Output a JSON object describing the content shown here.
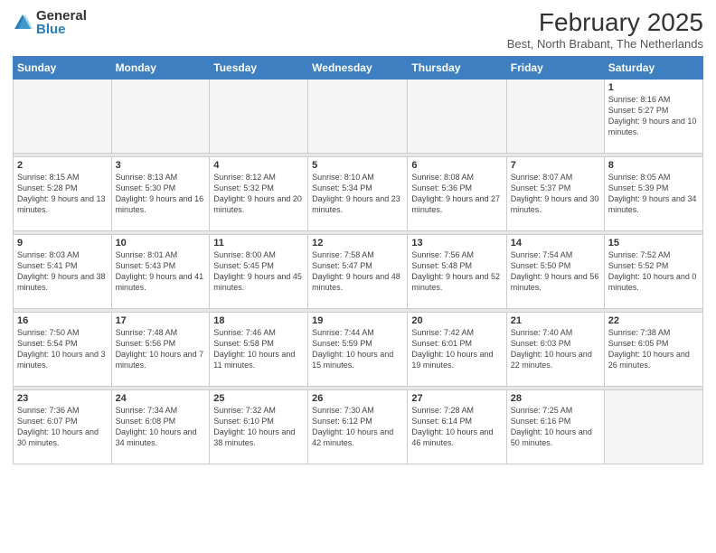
{
  "logo": {
    "general": "General",
    "blue": "Blue"
  },
  "title": {
    "main": "February 2025",
    "sub": "Best, North Brabant, The Netherlands"
  },
  "weekdays": [
    "Sunday",
    "Monday",
    "Tuesday",
    "Wednesday",
    "Thursday",
    "Friday",
    "Saturday"
  ],
  "weeks": [
    [
      {
        "day": "",
        "info": ""
      },
      {
        "day": "",
        "info": ""
      },
      {
        "day": "",
        "info": ""
      },
      {
        "day": "",
        "info": ""
      },
      {
        "day": "",
        "info": ""
      },
      {
        "day": "",
        "info": ""
      },
      {
        "day": "1",
        "info": "Sunrise: 8:16 AM\nSunset: 5:27 PM\nDaylight: 9 hours and 10 minutes."
      }
    ],
    [
      {
        "day": "2",
        "info": "Sunrise: 8:15 AM\nSunset: 5:28 PM\nDaylight: 9 hours and 13 minutes."
      },
      {
        "day": "3",
        "info": "Sunrise: 8:13 AM\nSunset: 5:30 PM\nDaylight: 9 hours and 16 minutes."
      },
      {
        "day": "4",
        "info": "Sunrise: 8:12 AM\nSunset: 5:32 PM\nDaylight: 9 hours and 20 minutes."
      },
      {
        "day": "5",
        "info": "Sunrise: 8:10 AM\nSunset: 5:34 PM\nDaylight: 9 hours and 23 minutes."
      },
      {
        "day": "6",
        "info": "Sunrise: 8:08 AM\nSunset: 5:36 PM\nDaylight: 9 hours and 27 minutes."
      },
      {
        "day": "7",
        "info": "Sunrise: 8:07 AM\nSunset: 5:37 PM\nDaylight: 9 hours and 30 minutes."
      },
      {
        "day": "8",
        "info": "Sunrise: 8:05 AM\nSunset: 5:39 PM\nDaylight: 9 hours and 34 minutes."
      }
    ],
    [
      {
        "day": "9",
        "info": "Sunrise: 8:03 AM\nSunset: 5:41 PM\nDaylight: 9 hours and 38 minutes."
      },
      {
        "day": "10",
        "info": "Sunrise: 8:01 AM\nSunset: 5:43 PM\nDaylight: 9 hours and 41 minutes."
      },
      {
        "day": "11",
        "info": "Sunrise: 8:00 AM\nSunset: 5:45 PM\nDaylight: 9 hours and 45 minutes."
      },
      {
        "day": "12",
        "info": "Sunrise: 7:58 AM\nSunset: 5:47 PM\nDaylight: 9 hours and 48 minutes."
      },
      {
        "day": "13",
        "info": "Sunrise: 7:56 AM\nSunset: 5:48 PM\nDaylight: 9 hours and 52 minutes."
      },
      {
        "day": "14",
        "info": "Sunrise: 7:54 AM\nSunset: 5:50 PM\nDaylight: 9 hours and 56 minutes."
      },
      {
        "day": "15",
        "info": "Sunrise: 7:52 AM\nSunset: 5:52 PM\nDaylight: 10 hours and 0 minutes."
      }
    ],
    [
      {
        "day": "16",
        "info": "Sunrise: 7:50 AM\nSunset: 5:54 PM\nDaylight: 10 hours and 3 minutes."
      },
      {
        "day": "17",
        "info": "Sunrise: 7:48 AM\nSunset: 5:56 PM\nDaylight: 10 hours and 7 minutes."
      },
      {
        "day": "18",
        "info": "Sunrise: 7:46 AM\nSunset: 5:58 PM\nDaylight: 10 hours and 11 minutes."
      },
      {
        "day": "19",
        "info": "Sunrise: 7:44 AM\nSunset: 5:59 PM\nDaylight: 10 hours and 15 minutes."
      },
      {
        "day": "20",
        "info": "Sunrise: 7:42 AM\nSunset: 6:01 PM\nDaylight: 10 hours and 19 minutes."
      },
      {
        "day": "21",
        "info": "Sunrise: 7:40 AM\nSunset: 6:03 PM\nDaylight: 10 hours and 22 minutes."
      },
      {
        "day": "22",
        "info": "Sunrise: 7:38 AM\nSunset: 6:05 PM\nDaylight: 10 hours and 26 minutes."
      }
    ],
    [
      {
        "day": "23",
        "info": "Sunrise: 7:36 AM\nSunset: 6:07 PM\nDaylight: 10 hours and 30 minutes."
      },
      {
        "day": "24",
        "info": "Sunrise: 7:34 AM\nSunset: 6:08 PM\nDaylight: 10 hours and 34 minutes."
      },
      {
        "day": "25",
        "info": "Sunrise: 7:32 AM\nSunset: 6:10 PM\nDaylight: 10 hours and 38 minutes."
      },
      {
        "day": "26",
        "info": "Sunrise: 7:30 AM\nSunset: 6:12 PM\nDaylight: 10 hours and 42 minutes."
      },
      {
        "day": "27",
        "info": "Sunrise: 7:28 AM\nSunset: 6:14 PM\nDaylight: 10 hours and 46 minutes."
      },
      {
        "day": "28",
        "info": "Sunrise: 7:25 AM\nSunset: 6:16 PM\nDaylight: 10 hours and 50 minutes."
      },
      {
        "day": "",
        "info": ""
      }
    ]
  ]
}
